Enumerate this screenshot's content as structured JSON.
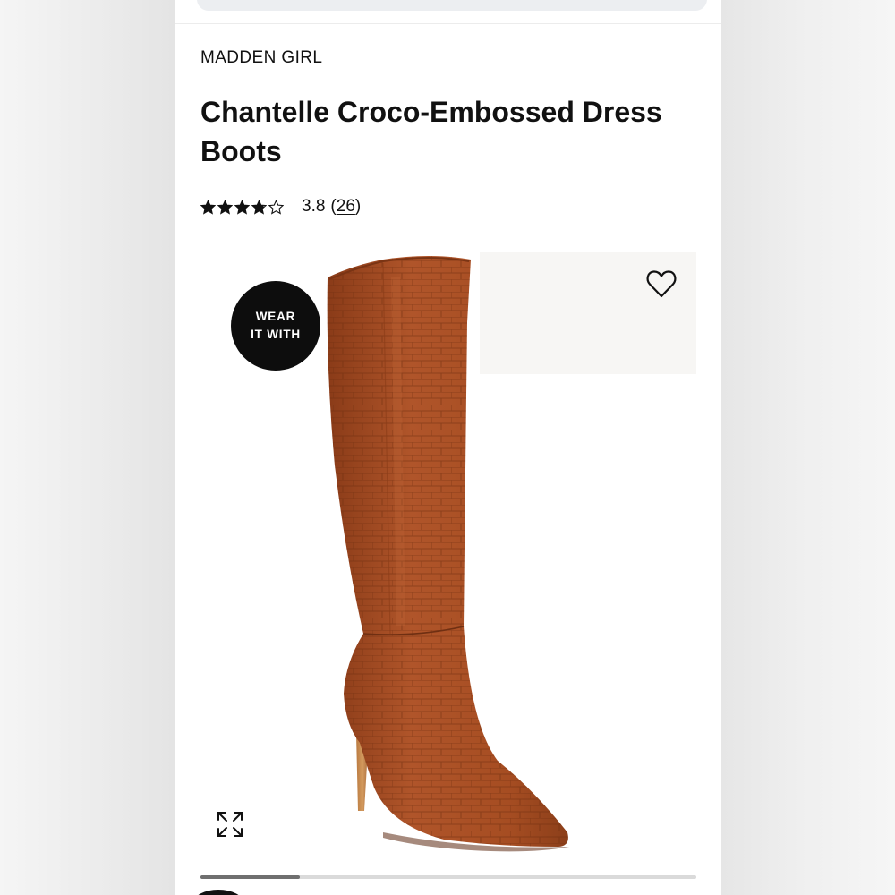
{
  "product": {
    "brand": "MADDEN GIRL",
    "title": "Chantelle Croco-Embossed Dress Boots",
    "rating": {
      "value": "3.8",
      "stars": 3.8,
      "max_stars": 5,
      "review_count": "26"
    }
  },
  "gallery": {
    "badge_line1": "WEAR",
    "badge_line2": "IT WITH",
    "progress_fraction": 0.2,
    "boot_color": "#a64d22"
  },
  "icons": {
    "favorite": "heart-outline-icon",
    "expand": "expand-arrows-icon",
    "star": "star-icon"
  }
}
